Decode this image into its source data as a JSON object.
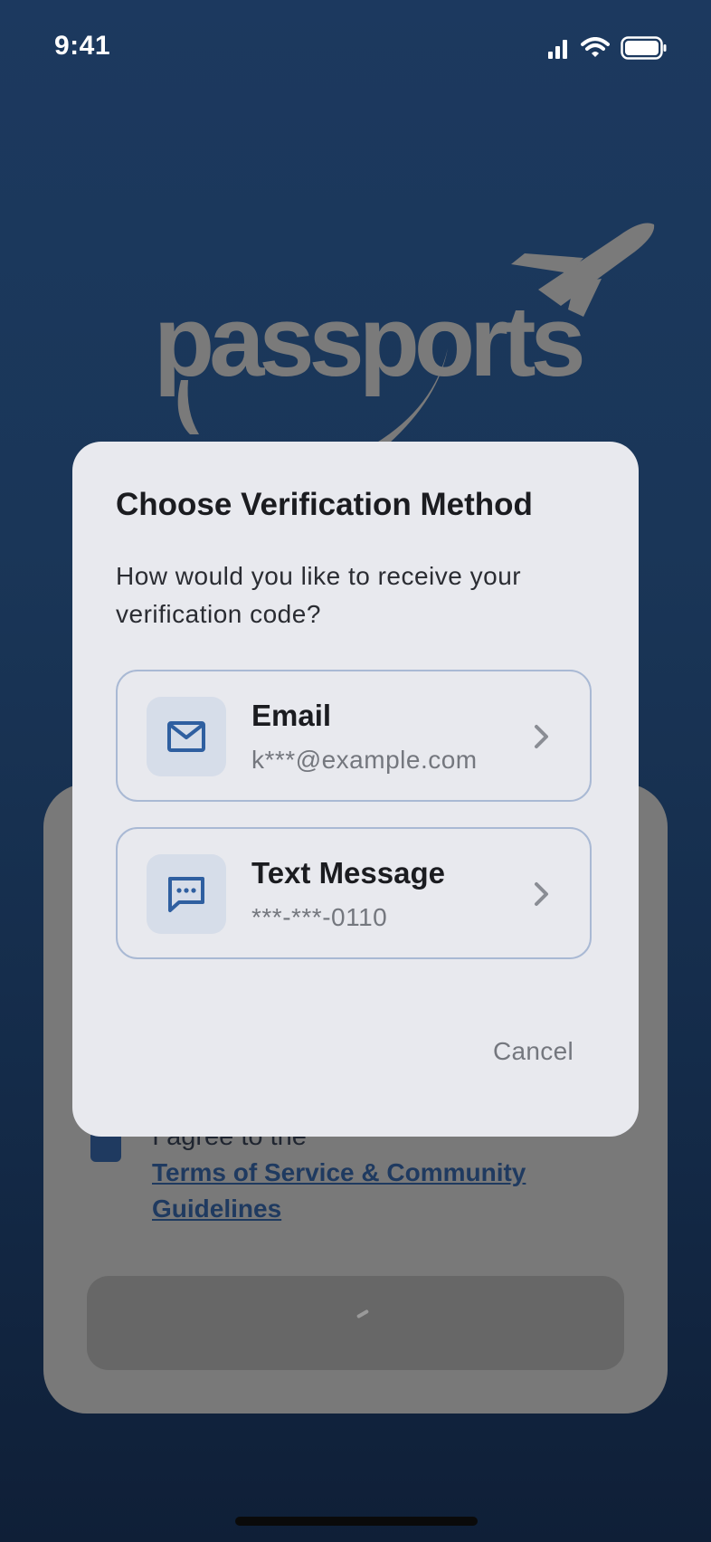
{
  "status_bar": {
    "time": "9:41"
  },
  "logo": {
    "text": "passports"
  },
  "background_form": {
    "agree_text": "I agree to the",
    "terms_link": "Terms of Service & Community Guidelines"
  },
  "dialog": {
    "title": "Choose Verification Method",
    "body": "How would you like to receive your verification code?",
    "options": [
      {
        "title": "Email",
        "subtitle": "k***@example.com",
        "icon": "mail-icon"
      },
      {
        "title": "Text Message",
        "subtitle": "***-***-0110",
        "icon": "message-icon"
      }
    ],
    "cancel_label": "Cancel"
  },
  "colors": {
    "accent": "#2f5fa0",
    "dialog_bg": "#e8e9ee",
    "option_border": "#a9b9d4",
    "icon_box_bg": "#d6dde9"
  }
}
